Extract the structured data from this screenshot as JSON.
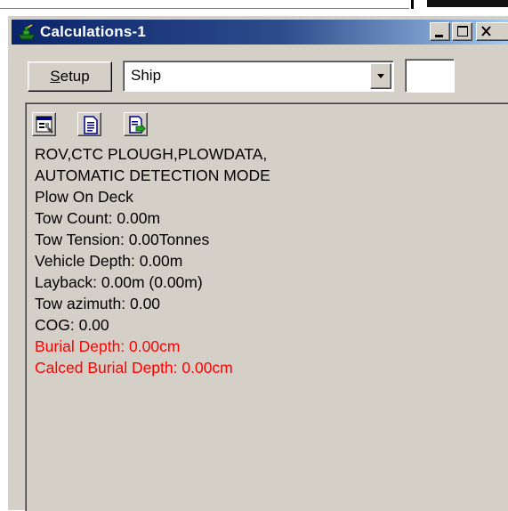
{
  "window": {
    "title": "Calculations-1",
    "icon": "ship-app-icon",
    "controls": [
      "minimize-icon",
      "maximize-icon",
      "close-icon"
    ]
  },
  "toolbar": {
    "setup_label_underlined": "S",
    "setup_label_rest": "etup",
    "combo_value": "Ship",
    "combo_arrow_icon": "chevron-down-icon",
    "small_box_value": ""
  },
  "panel": {
    "buttons": [
      {
        "icon": "report-icon"
      },
      {
        "icon": "document-icon"
      },
      {
        "icon": "export-icon"
      }
    ],
    "lines": [
      {
        "text": "ROV,CTC PLOUGH,PLOWDATA,",
        "color": "#000000"
      },
      {
        "text": "AUTOMATIC DETECTION MODE",
        "color": "#000000"
      },
      {
        "text": "Plow On Deck",
        "color": "#000000"
      },
      {
        "text": "Tow Count: 0.00m",
        "color": "#000000"
      },
      {
        "text": "Tow Tension: 0.00Tonnes",
        "color": "#000000"
      },
      {
        "text": "Vehicle Depth: 0.00m",
        "color": "#000000"
      },
      {
        "text": "Layback: 0.00m (0.00m)",
        "color": "#000000"
      },
      {
        "text": "Tow azimuth: 0.00",
        "color": "#000000"
      },
      {
        "text": "COG: 0.00",
        "color": "#000000"
      },
      {
        "text": "Burial Depth: 0.00cm",
        "color": "#ff0000"
      },
      {
        "text": "Calced Burial Depth: 0.00cm",
        "color": "#ff0000"
      }
    ]
  },
  "colors": {
    "titlebar_start": "#0a246a",
    "titlebar_end": "#a6caf0",
    "face": "#d4d0c8",
    "alert_text": "#ff0000"
  }
}
